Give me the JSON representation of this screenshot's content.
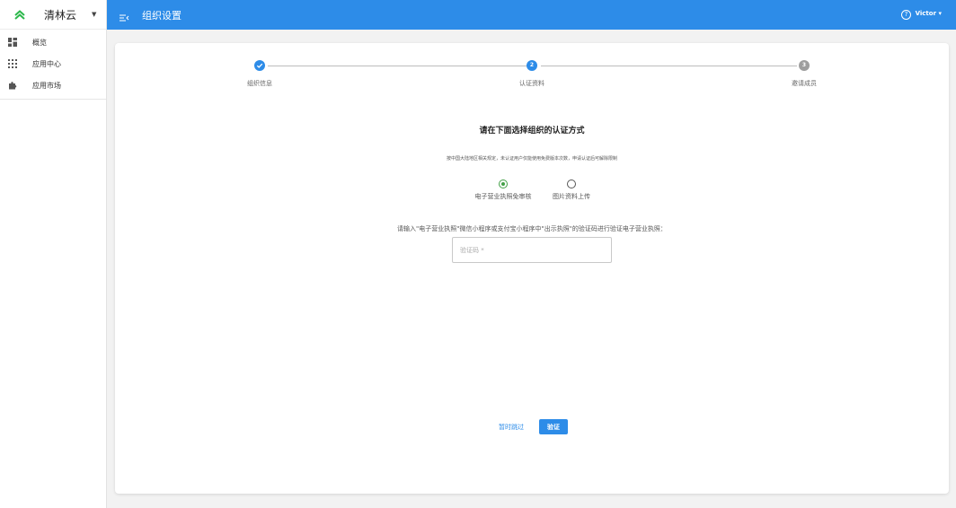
{
  "brand": {
    "name": "清林云",
    "logo_color": "#2db84c"
  },
  "sidebar": {
    "items": [
      {
        "label": "概览",
        "icon": "dashboard-icon"
      },
      {
        "label": "应用中心",
        "icon": "apps-grid-icon"
      },
      {
        "label": "应用市场",
        "icon": "puzzle-icon"
      }
    ]
  },
  "header": {
    "title": "组织设置",
    "user": "Victor ▾",
    "help_symbol": "?",
    "accent": "#2d8ce8"
  },
  "stepper": {
    "steps": [
      {
        "label": "组织信息",
        "number": "",
        "status": "done"
      },
      {
        "label": "认证资料",
        "number": "2",
        "status": "active"
      },
      {
        "label": "邀请成员",
        "number": "3",
        "status": "pending"
      }
    ]
  },
  "form": {
    "heading": "请在下面选择组织的认证方式",
    "notice": "按中国大陆地区相关规定，未认证用户仅能使用免费版本次数，申请认证后可解除限制",
    "options": [
      {
        "label": "电子营业执照免审核",
        "selected": true
      },
      {
        "label": "图片资料上传",
        "selected": false
      }
    ],
    "instruction": "请输入\"电子营业执照\"微信小程序或支付宝小程序中\"出示执照\"的验证码进行验证电子营业执照：",
    "code_placeholder": "验证码 *",
    "code_value": ""
  },
  "actions": {
    "skip": "暂时跳过",
    "verify": "验证"
  }
}
